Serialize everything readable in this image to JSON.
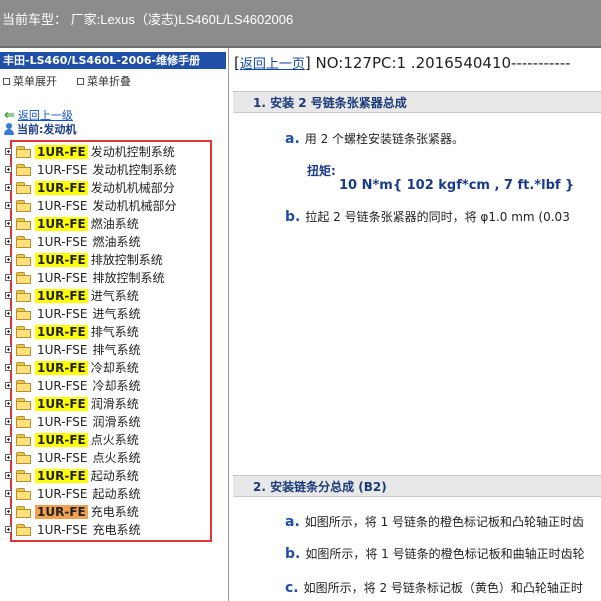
{
  "topbar": {
    "car_label": "当前车型： 厂家:Lexus（凌志)LS460L/LS4602006"
  },
  "left": {
    "manual_title": "丰田-LS460/LS460L-2006-维修手册",
    "expand_label": "菜单展开",
    "collapse_label": "菜单折叠",
    "back_label": "返回上一级",
    "current_label": "当前:发动机",
    "tree": [
      {
        "tag": "1UR-FE",
        "label": "发动机控制系统",
        "hl": "yellow"
      },
      {
        "tag": "1UR-FSE",
        "label": "发动机控制系统",
        "hl": ""
      },
      {
        "tag": "1UR-FE",
        "label": "发动机机械部分",
        "hl": "yellow"
      },
      {
        "tag": "1UR-FSE",
        "label": "发动机机械部分",
        "hl": ""
      },
      {
        "tag": "1UR-FE",
        "label": "燃油系统",
        "hl": "yellow"
      },
      {
        "tag": "1UR-FSE",
        "label": "燃油系统",
        "hl": ""
      },
      {
        "tag": "1UR-FE",
        "label": "排放控制系统",
        "hl": "yellow"
      },
      {
        "tag": "1UR-FSE",
        "label": "排放控制系统",
        "hl": ""
      },
      {
        "tag": "1UR-FE",
        "label": "进气系统",
        "hl": "yellow"
      },
      {
        "tag": "1UR-FSE",
        "label": "进气系统",
        "hl": ""
      },
      {
        "tag": "1UR-FE",
        "label": "排气系统",
        "hl": "yellow"
      },
      {
        "tag": "1UR-FSE",
        "label": "排气系统",
        "hl": ""
      },
      {
        "tag": "1UR-FE",
        "label": "冷却系统",
        "hl": "yellow"
      },
      {
        "tag": "1UR-FSE",
        "label": "冷却系统",
        "hl": ""
      },
      {
        "tag": "1UR-FE",
        "label": "润滑系统",
        "hl": "yellow"
      },
      {
        "tag": "1UR-FSE",
        "label": "润滑系统",
        "hl": ""
      },
      {
        "tag": "1UR-FE",
        "label": "点火系统",
        "hl": "yellow"
      },
      {
        "tag": "1UR-FSE",
        "label": "点火系统",
        "hl": ""
      },
      {
        "tag": "1UR-FE",
        "label": "起动系统",
        "hl": "yellow"
      },
      {
        "tag": "1UR-FSE",
        "label": "起动系统",
        "hl": ""
      },
      {
        "tag": "1UR-FE",
        "label": "充电系统",
        "hl": "orange"
      },
      {
        "tag": "1UR-FSE",
        "label": "充电系统",
        "hl": ""
      }
    ]
  },
  "right": {
    "back_link": "返回上一页",
    "doc_no": "NO:127PC:1 .2016540410-----------",
    "section1_title": "1. 安装 2 号链条张紧器总成",
    "step1a_letter": "a.",
    "step1a_text": "用 2 个螺栓安装链条张紧器。",
    "torque_label": "扭矩:",
    "torque_value": "10 N*m{ 102 kgf*cm , 7 ft.*lbf }",
    "step1b_letter": "b.",
    "step1b_text": "拉起 2 号链条张紧器的同时，将 φ1.0 mm (0.03",
    "section2_title": "2. 安装链条分总成 (B2)",
    "step2a_letter": "a.",
    "step2a_text": "如图所示，将 1 号链条的橙色标记板和凸轮轴正时齿",
    "step2b_letter": "b.",
    "step2b_text": "如图所示，将 1 号链条的橙色标记板和曲轴正时齿轮",
    "step2c_letter": "c.",
    "step2c_text": "如图所示，将 2 号链条标记板（黄色）和凸轮轴正时"
  },
  "colors": {
    "topbar": "#8c8c8c",
    "manual_title_bg": "#1f4fa6",
    "highlight": "#ffff00",
    "highlight_active": "#f0a050",
    "tree_border": "#e23636"
  }
}
